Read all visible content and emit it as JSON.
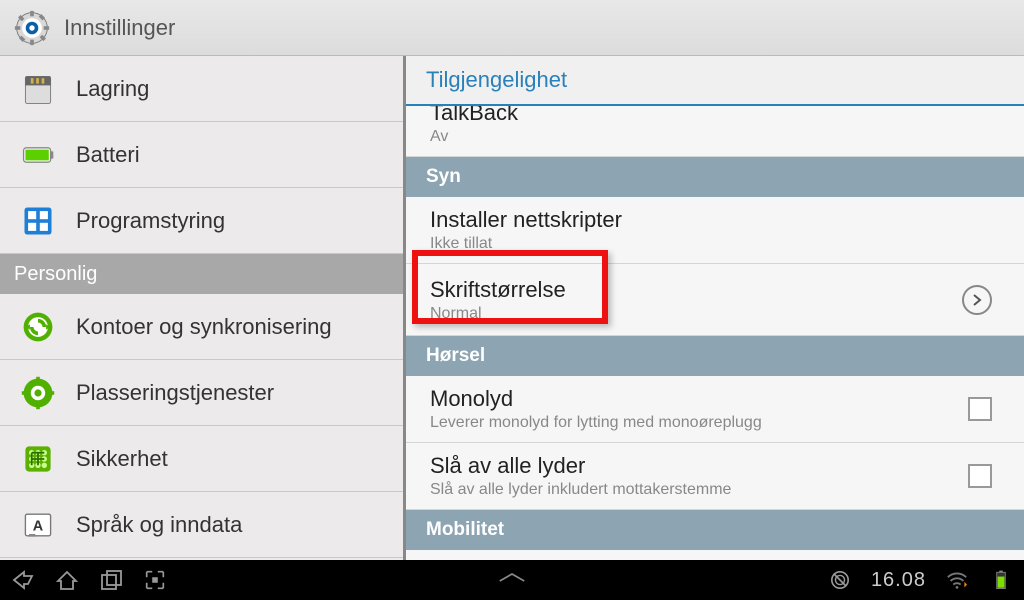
{
  "header": {
    "title": "Innstillinger"
  },
  "sidebar": {
    "items": [
      {
        "label": "Lagring",
        "icon": "storage"
      },
      {
        "label": "Batteri",
        "icon": "battery"
      },
      {
        "label": "Programstyring",
        "icon": "apps"
      }
    ],
    "section": "Personlig",
    "items2": [
      {
        "label": "Kontoer og synkronisering",
        "icon": "sync"
      },
      {
        "label": "Plasseringstjenester",
        "icon": "location"
      },
      {
        "label": "Sikkerhet",
        "icon": "security"
      },
      {
        "label": "Språk og inndata",
        "icon": "language"
      }
    ]
  },
  "content": {
    "header": "Tilgjengelighet",
    "talkback": {
      "title": "TalkBack",
      "sub": "Av"
    },
    "sec_syn": "Syn",
    "webscripts": {
      "title": "Installer nettskripter",
      "sub": "Ikke tillat"
    },
    "fontsize": {
      "title": "Skriftstørrelse",
      "sub": "Normal"
    },
    "sec_hearing": "Hørsel",
    "mono": {
      "title": "Monolyd",
      "sub": "Leverer monolyd for lytting med monoøreplugg"
    },
    "mute": {
      "title": "Slå av alle lyder",
      "sub": "Slå av alle lyder inkludert mottakerstemme"
    },
    "sec_mobility": "Mobilitet"
  },
  "statusbar": {
    "time": "16.08"
  }
}
